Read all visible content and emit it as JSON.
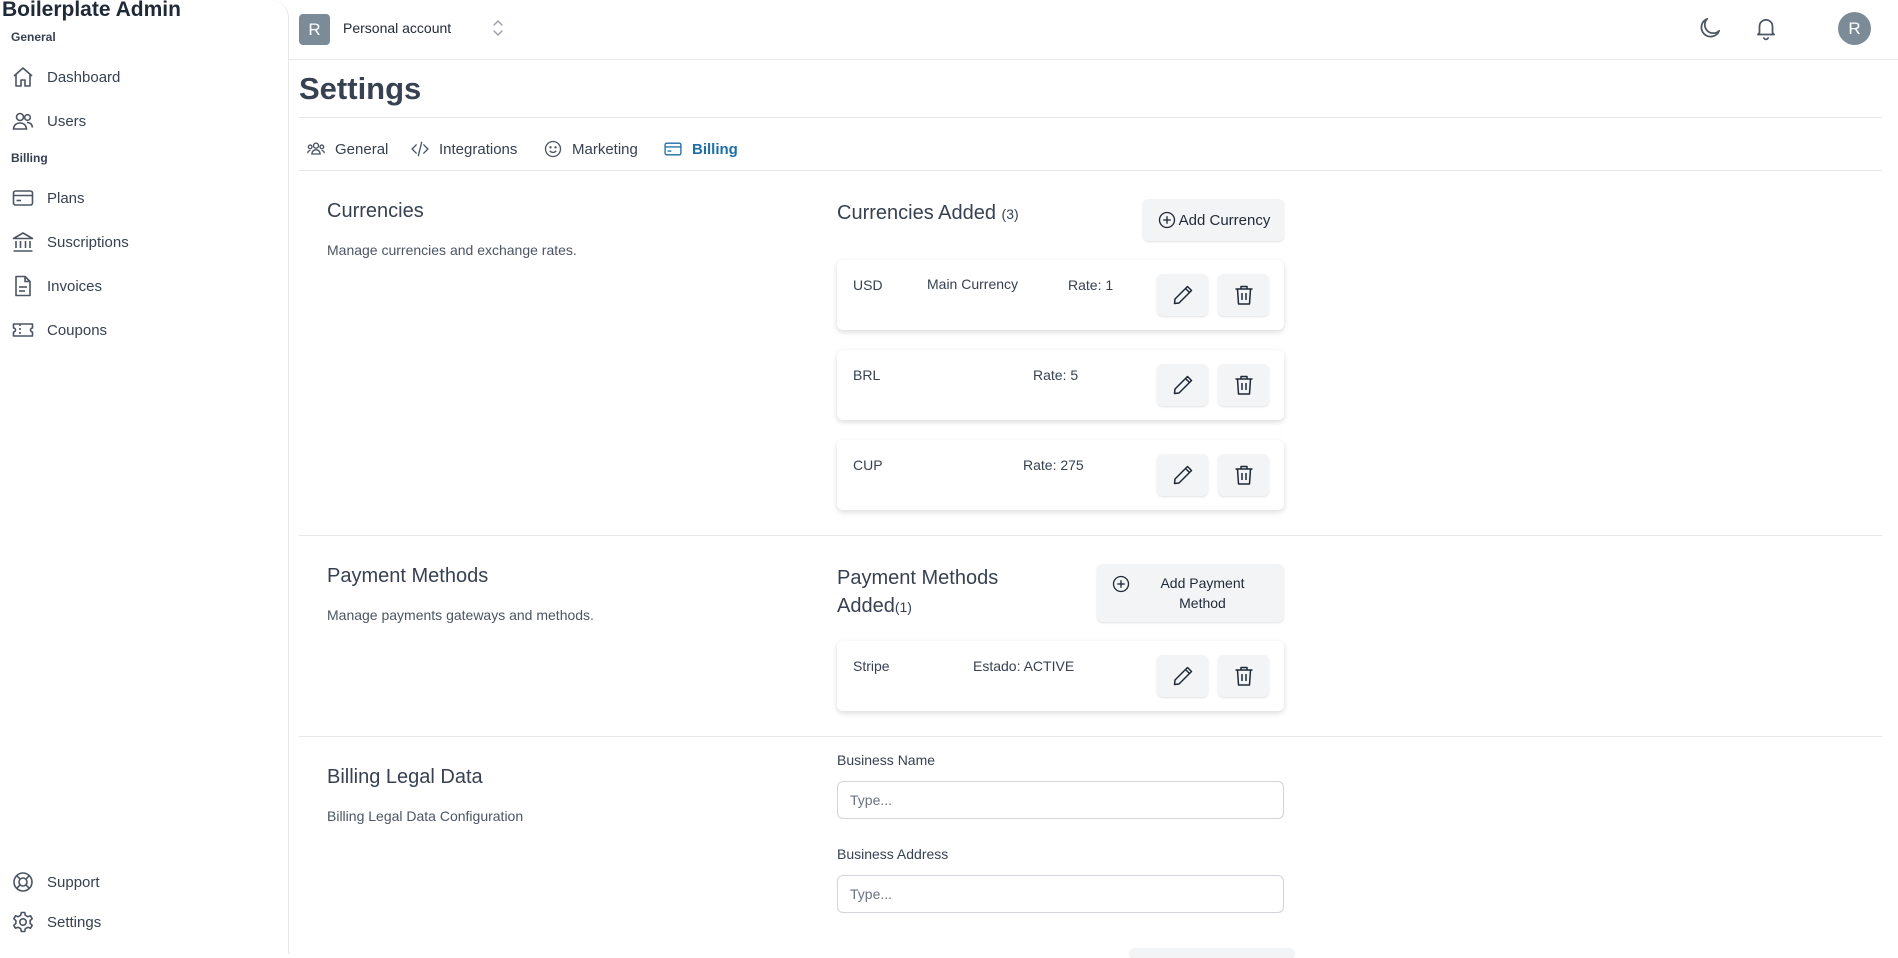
{
  "app": {
    "title": "Boilerplate Admin"
  },
  "sidebar": {
    "sections": [
      {
        "label": "General",
        "items": [
          {
            "label": "Dashboard",
            "icon": "home-icon"
          },
          {
            "label": "Users",
            "icon": "users-icon"
          }
        ]
      },
      {
        "label": "Billing",
        "items": [
          {
            "label": "Plans",
            "icon": "credit-card-icon"
          },
          {
            "label": "Suscriptions",
            "icon": "bank-icon"
          },
          {
            "label": "Invoices",
            "icon": "document-icon"
          },
          {
            "label": "Coupons",
            "icon": "ticket-icon"
          }
        ]
      }
    ],
    "footer": [
      {
        "label": "Support",
        "icon": "lifebuoy-icon"
      },
      {
        "label": "Settings",
        "icon": "gear-icon"
      }
    ]
  },
  "header": {
    "account_initial": "R",
    "account_name": "Personal account",
    "user_initial": "R"
  },
  "page": {
    "title": "Settings"
  },
  "tabs": [
    {
      "label": "General",
      "icon": "users-group-icon",
      "active": false
    },
    {
      "label": "Integrations",
      "icon": "code-icon",
      "active": false
    },
    {
      "label": "Marketing",
      "icon": "smiley-icon",
      "active": false
    },
    {
      "label": "Billing",
      "icon": "credit-card-icon",
      "active": true
    }
  ],
  "currencies": {
    "title": "Currencies",
    "description": "Manage currencies and exchange rates.",
    "added_title": "Currencies Added",
    "added_count": "(3)",
    "add_button": "Add Currency",
    "items": [
      {
        "code": "USD",
        "tag": "Main Currency",
        "rate": "Rate: 1"
      },
      {
        "code": "BRL",
        "tag": "",
        "rate": "Rate: 5"
      },
      {
        "code": "CUP",
        "tag": "",
        "rate": "Rate: 275"
      }
    ]
  },
  "payment_methods": {
    "title": "Payment Methods",
    "description": "Manage payments gateways and methods.",
    "added_title_line1": "Payment Methods",
    "added_title_line2": "Added",
    "added_count": "(1)",
    "add_button_line1": "Add Payment",
    "add_button_line2": "Method",
    "items": [
      {
        "name": "Stripe",
        "status": "Estado: ACTIVE"
      }
    ]
  },
  "billing_legal": {
    "title": "Billing Legal Data",
    "description": "Billing Legal Data Configuration",
    "fields": [
      {
        "label": "Business Name",
        "value": "",
        "placeholder": "Type..."
      },
      {
        "label": "Business Address",
        "value": "",
        "placeholder": "Type..."
      }
    ]
  },
  "colors": {
    "accent": "#1d6fa8",
    "avatar": "#7b8c98",
    "border": "#e5e7eb"
  }
}
